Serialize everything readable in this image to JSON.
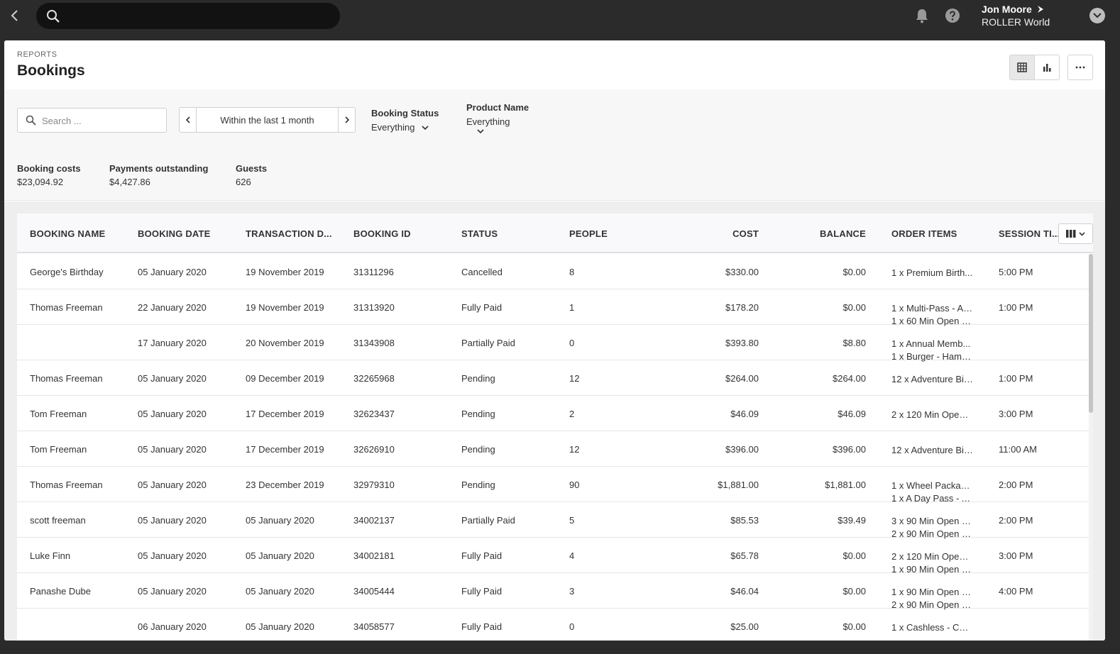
{
  "topbar": {
    "user_name": "Jon Moore",
    "org_name": "ROLLER World"
  },
  "header": {
    "eyebrow": "REPORTS",
    "title": "Bookings"
  },
  "filters": {
    "search_placeholder": "Search ...",
    "date_range": "Within the last 1 month",
    "booking_status_label": "Booking Status",
    "booking_status_value": "Everything",
    "product_name_label": "Product Name",
    "product_name_value": "Everything"
  },
  "stats": {
    "booking_costs_label": "Booking costs",
    "booking_costs_value": "$23,094.92",
    "payments_outstanding_label": "Payments outstanding",
    "payments_outstanding_value": "$4,427.86",
    "guests_label": "Guests",
    "guests_value": "626"
  },
  "table": {
    "headers": [
      "BOOKING NAME",
      "BOOKING DATE",
      "TRANSACTION D...",
      "BOOKING ID",
      "STATUS",
      "PEOPLE",
      "COST",
      "BALANCE",
      "ORDER ITEMS",
      "SESSION TI..."
    ],
    "rows": [
      [
        "George's Birthday",
        "05 January 2020",
        "19 November 2019",
        "31311296",
        "Cancelled",
        "8",
        "$330.00",
        "$0.00",
        "1 x Premium Birth...",
        "",
        "5:00 PM"
      ],
      [
        "Thomas Freeman",
        "22 January 2020",
        "19 November 2019",
        "31313920",
        "Fully Paid",
        "1",
        "$178.20",
        "$0.00",
        "1 x Multi-Pass - Ad...",
        "1 x 60 Min Open J...",
        "1:00 PM"
      ],
      [
        "",
        "17 January 2020",
        "20 November 2019",
        "31343908",
        "Partially Paid",
        "0",
        "$393.80",
        "$8.80",
        "1 x Annual Memb...",
        "1 x Burger - Hamb...",
        ""
      ],
      [
        "Thomas Freeman",
        "05 January 2020",
        "09 December 2019",
        "32265968",
        "Pending",
        "12",
        "$264.00",
        "$264.00",
        "12 x Adventure Bir...",
        "",
        "1:00 PM"
      ],
      [
        "Tom Freeman",
        "05 January 2020",
        "17 December 2019",
        "32623437",
        "Pending",
        "2",
        "$46.09",
        "$46.09",
        "2 x 120 Min Open ...",
        "",
        "3:00 PM"
      ],
      [
        "Tom Freeman",
        "05 January 2020",
        "17 December 2019",
        "32626910",
        "Pending",
        "12",
        "$396.00",
        "$396.00",
        "12 x Adventure Bir...",
        "",
        "11:00 AM"
      ],
      [
        "Thomas Freeman",
        "05 January 2020",
        "23 December 2019",
        "32979310",
        "Pending",
        "90",
        "$1,881.00",
        "$1,881.00",
        "1 x Wheel Packag...",
        "1 x A Day Pass - A...",
        "2:00 PM"
      ],
      [
        "scott freeman",
        "05 January 2020",
        "05 January 2020",
        "34002137",
        "Partially Paid",
        "5",
        "$85.53",
        "$39.49",
        "3 x 90 Min Open J...",
        "2 x 90 Min Open J...",
        "2:00 PM"
      ],
      [
        "Luke Finn",
        "05 January 2020",
        "05 January 2020",
        "34002181",
        "Fully Paid",
        "4",
        "$65.78",
        "$0.00",
        "2 x 120 Min Open ...",
        "1 x 90 Min Open J...",
        "3:00 PM"
      ],
      [
        "Panashe Dube",
        "05 January 2020",
        "05 January 2020",
        "34005444",
        "Fully Paid",
        "3",
        "$46.04",
        "$0.00",
        "1 x 90 Min Open J...",
        "2 x 90 Min Open J...",
        "4:00 PM"
      ],
      [
        "",
        "06 January 2020",
        "05 January 2020",
        "34058577",
        "Fully Paid",
        "0",
        "$25.00",
        "$0.00",
        "1 x Cashless - Cas...",
        "",
        ""
      ]
    ]
  },
  "icons": {
    "back": "chevron-left-icon",
    "search": "search-icon",
    "bell": "bell-icon",
    "help": "help-icon",
    "user_menu": "chevron-down-icon",
    "table_view": "table-grid-icon",
    "chart_view": "bar-chart-icon",
    "more": "more-horizontal-icon",
    "columns": "columns-icon"
  },
  "colors": {
    "topbar_bg": "#2b2b2b",
    "card_bg": "#ffffff",
    "filter_bg": "#f7f7f8"
  }
}
